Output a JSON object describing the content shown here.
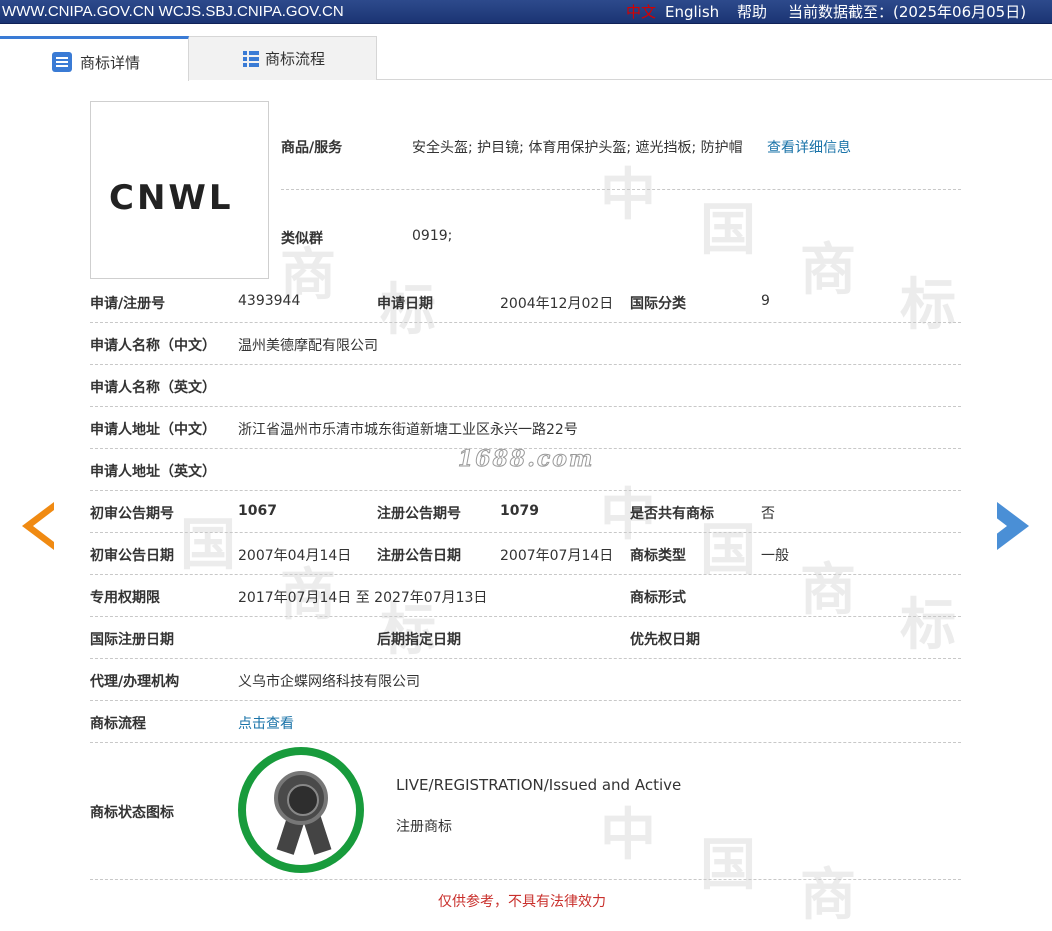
{
  "topbar": {
    "site": "WWW.CNIPA.GOV.CN WCJS.SBJ.CNIPA.GOV.CN",
    "lang_cn": "中文",
    "lang_en": "English",
    "help": "帮助",
    "data_date": "当前数据截至：(2025年06月05日)"
  },
  "tabs": [
    {
      "label": "商标详情",
      "icon": "list-icon",
      "active": true
    },
    {
      "label": "商标流程",
      "icon": "table-icon",
      "active": false
    }
  ],
  "trademark_image": {
    "text": "CNWL"
  },
  "goods": {
    "label": "商品/服务",
    "value": "安全头盔; 护目镜; 体育用保护头盔; 遮光挡板; 防护帽",
    "detail_link": "查看详细信息"
  },
  "similar_group": {
    "label": "类似群",
    "value": "0919;"
  },
  "rows": {
    "reg_no": {
      "label": "申请/注册号",
      "value": "4393944"
    },
    "app_date": {
      "label": "申请日期",
      "value": "2004年12月02日"
    },
    "intl_class": {
      "label": "国际分类",
      "value": "9"
    },
    "applicant_cn": {
      "label": "申请人名称（中文）",
      "value": "温州美德摩配有限公司"
    },
    "applicant_en": {
      "label": "申请人名称（英文）",
      "value": ""
    },
    "address_cn": {
      "label": "申请人地址（中文）",
      "value": "浙江省温州市乐清市城东街道新塘工业区永兴一路22号"
    },
    "address_en": {
      "label": "申请人地址（英文）",
      "value": ""
    },
    "prelim_issue": {
      "label": "初审公告期号",
      "value": "1067"
    },
    "reg_issue": {
      "label": "注册公告期号",
      "value": "1079"
    },
    "shared": {
      "label": "是否共有商标",
      "value": "否"
    },
    "prelim_date": {
      "label": "初审公告日期",
      "value": "2007年04月14日"
    },
    "reg_date": {
      "label": "注册公告日期",
      "value": "2007年07月14日"
    },
    "mark_type": {
      "label": "商标类型",
      "value": "一般"
    },
    "exclusive_period": {
      "label": "专用权期限",
      "value": "2017年07月14日 至 2027年07月13日"
    },
    "mark_form": {
      "label": "商标形式",
      "value": ""
    },
    "intl_reg_date": {
      "label": "国际注册日期",
      "value": ""
    },
    "later_designation": {
      "label": "后期指定日期",
      "value": ""
    },
    "priority_date": {
      "label": "优先权日期",
      "value": ""
    },
    "agent": {
      "label": "代理/办理机构",
      "value": "义乌市企蝶网络科技有限公司"
    },
    "flow": {
      "label": "商标流程",
      "value": "点击查看"
    }
  },
  "status": {
    "label": "商标状态图标",
    "en": "LIVE/REGISTRATION/Issued and Active",
    "cn": "注册商标",
    "icon": "rosette-badge-icon"
  },
  "watermark_1688": "1688.com",
  "footer": "仅供参考，不具有法律效力",
  "colors": {
    "topbar": "#1b3473",
    "link": "#1a73a8",
    "badge": "#189b3c",
    "footer": "#c9302c",
    "prev_arrow": "#f08a12",
    "next_arrow": "#4a8fd6"
  }
}
